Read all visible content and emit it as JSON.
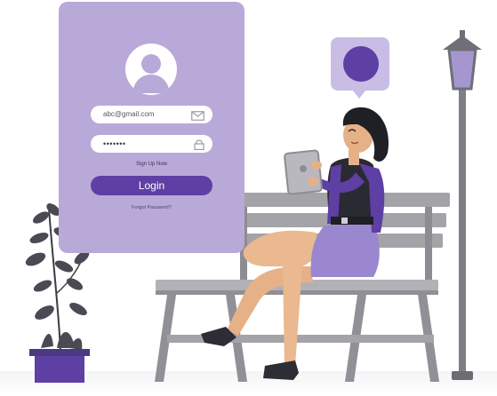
{
  "login": {
    "email_value": "abc@gmail.com",
    "password_value": "•••••••",
    "signup_label": "Sign Up Now",
    "login_label": "Login",
    "forgot_label": "Forgot Password?"
  },
  "icons": [
    "user-icon",
    "mail-icon",
    "lock-icon",
    "chat-bubble-icon"
  ],
  "colors": {
    "card": "#b9a9d8",
    "accent": "#5e3fa3",
    "bench": "#a3a3a8",
    "skin": "#e7b187"
  }
}
